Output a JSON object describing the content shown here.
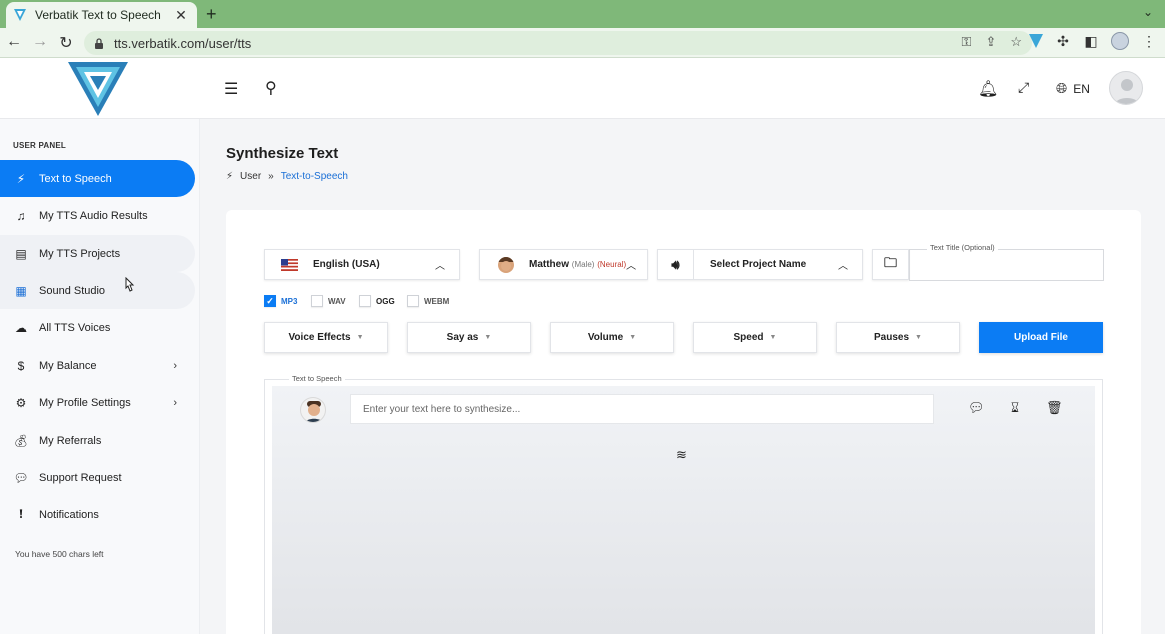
{
  "browser": {
    "tab_title": "Verbatik Text to Speech",
    "new_tab": "+",
    "tab_close": "✕",
    "tab_menu": "⌄",
    "url": "tts.verbatik.com/user/tts"
  },
  "header": {
    "language": "EN"
  },
  "sidebar": {
    "panel_label": "USER PANEL",
    "items": [
      {
        "label": "Text to Speech",
        "icon": "magic-wand-icon"
      },
      {
        "label": "My TTS Audio Results",
        "icon": "music-file-icon"
      },
      {
        "label": "My TTS Projects",
        "icon": "projects-icon"
      },
      {
        "label": "Sound Studio",
        "icon": "sound-studio-icon"
      },
      {
        "label": "All TTS Voices",
        "icon": "cloud-icon"
      },
      {
        "label": "My Balance",
        "icon": "dollar-icon"
      },
      {
        "label": "My Profile Settings",
        "icon": "user-gear-icon"
      },
      {
        "label": "My Referrals",
        "icon": "money-bag-icon"
      },
      {
        "label": "Support Request",
        "icon": "chat-icon"
      },
      {
        "label": "Notifications",
        "icon": "alert-icon"
      }
    ],
    "chars_left": "You have 500 chars left"
  },
  "main": {
    "title": "Synthesize Text",
    "breadcrumb": {
      "root": "User",
      "sep": "»",
      "current": "Text-to-Speech"
    }
  },
  "form": {
    "language": "English (USA)",
    "voice_name": "Matthew",
    "voice_gender": "(Male)",
    "voice_type": "(Neural)",
    "project": "Select Project Name",
    "text_title_label": "Text Title (Optional)",
    "formats": [
      {
        "label": "MP3",
        "checked": true
      },
      {
        "label": "WAV",
        "checked": false
      },
      {
        "label": "OGG",
        "checked": false
      },
      {
        "label": "WEBM",
        "checked": false
      }
    ],
    "dropdowns": [
      "Voice Effects",
      "Say as",
      "Volume",
      "Speed",
      "Pauses"
    ],
    "upload_label": "Upload File",
    "tts_label": "Text to Speech",
    "tts_placeholder": "Enter your text here to synthesize..."
  },
  "colors": {
    "accent": "#0b7cf4",
    "browser_frame": "#7fb879",
    "link": "#1a6fd6"
  }
}
